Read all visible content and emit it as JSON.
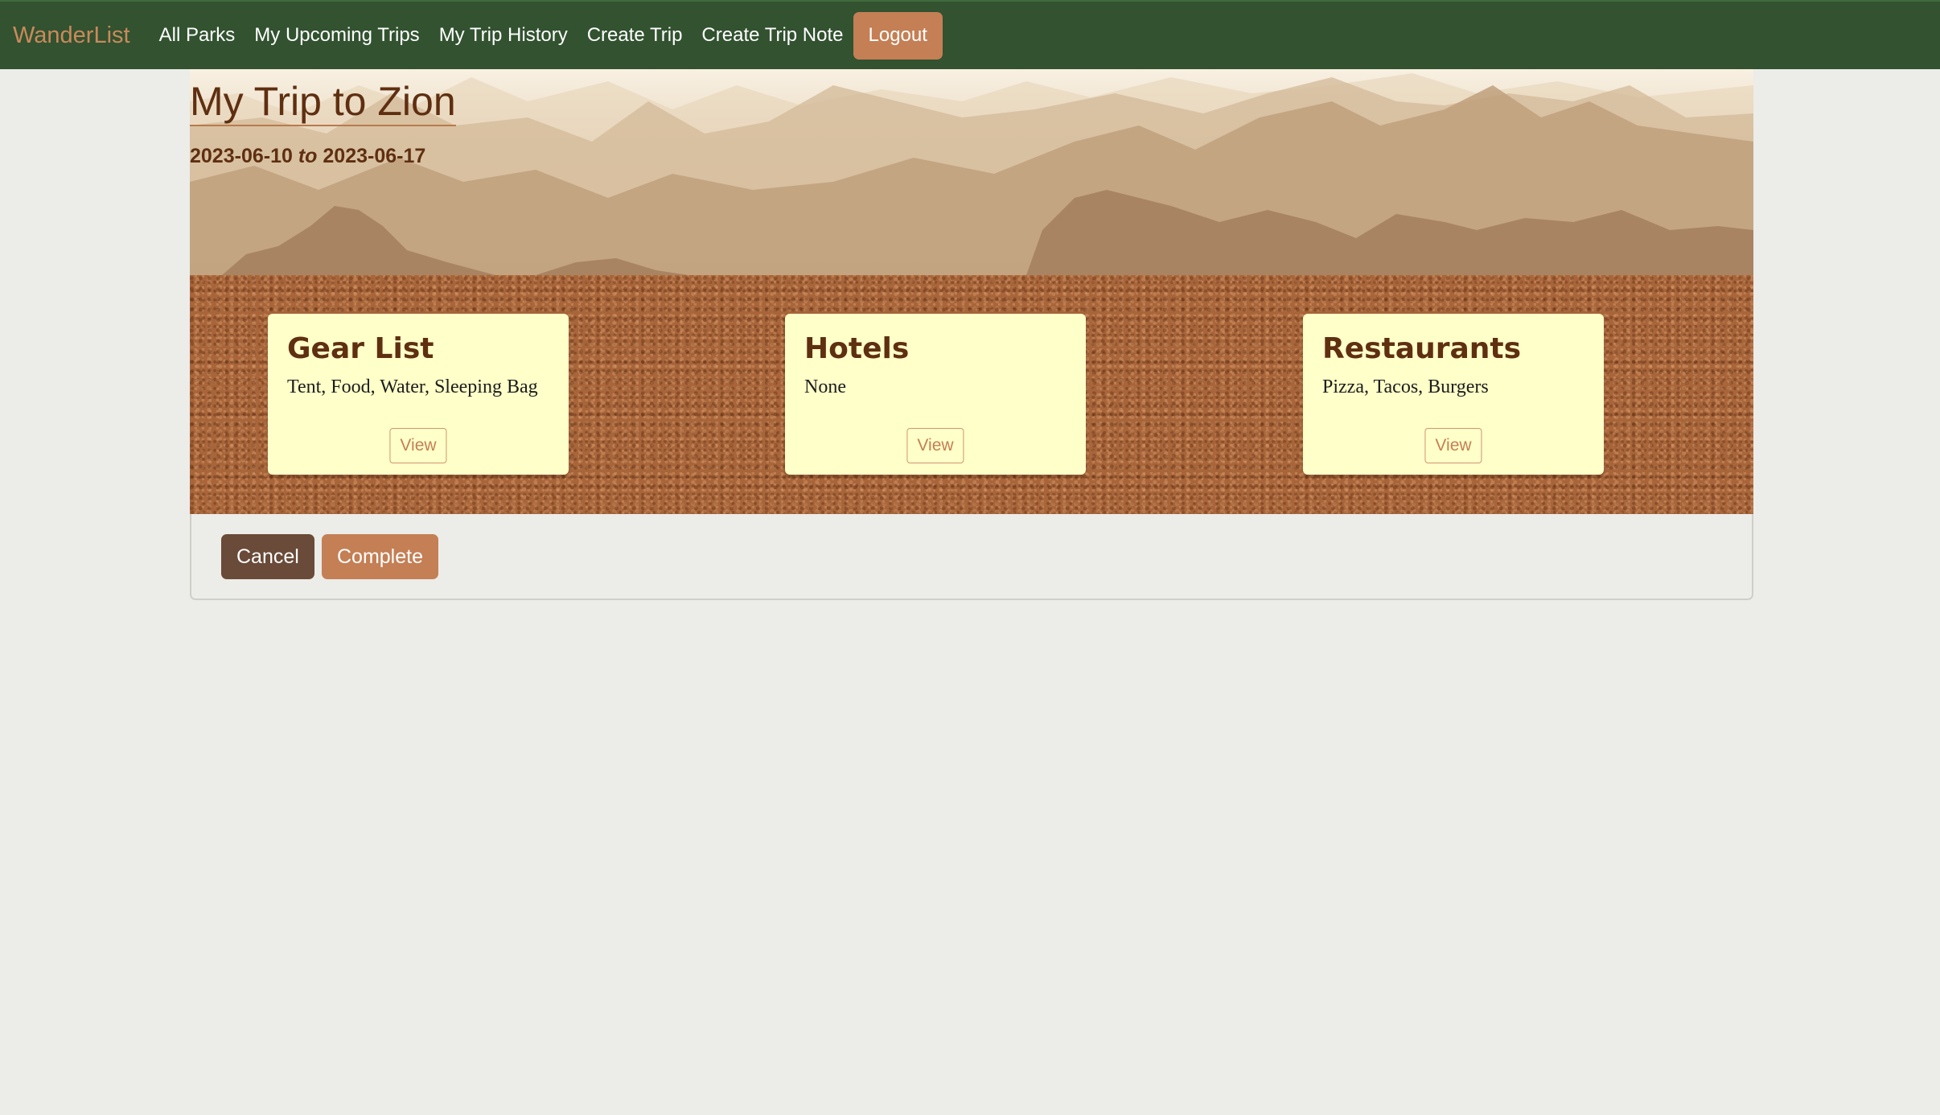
{
  "nav": {
    "brand": "WanderList",
    "links": [
      "All Parks",
      "My Upcoming Trips",
      "My Trip History",
      "Create Trip",
      "Create Trip Note"
    ],
    "logout": "Logout"
  },
  "trip": {
    "title": "My Trip to Zion",
    "start_date": "2023-06-10",
    "date_separator": "to",
    "end_date": "2023-06-17"
  },
  "notes": [
    {
      "title": "Gear List",
      "content": "Tent, Food, Water, Sleeping Bag",
      "button": "View"
    },
    {
      "title": "Hotels",
      "content": "None",
      "button": "View"
    },
    {
      "title": "Restaurants",
      "content": "Pizza, Tacos, Burgers",
      "button": "View"
    }
  ],
  "actions": {
    "cancel": "Cancel",
    "complete": "Complete"
  },
  "colors": {
    "navbar": "#325230",
    "accent": "#c47f55",
    "title_brown": "#5f2f11",
    "note_yellow": "#ffffc9",
    "cancel_brown": "#6a4a38"
  }
}
